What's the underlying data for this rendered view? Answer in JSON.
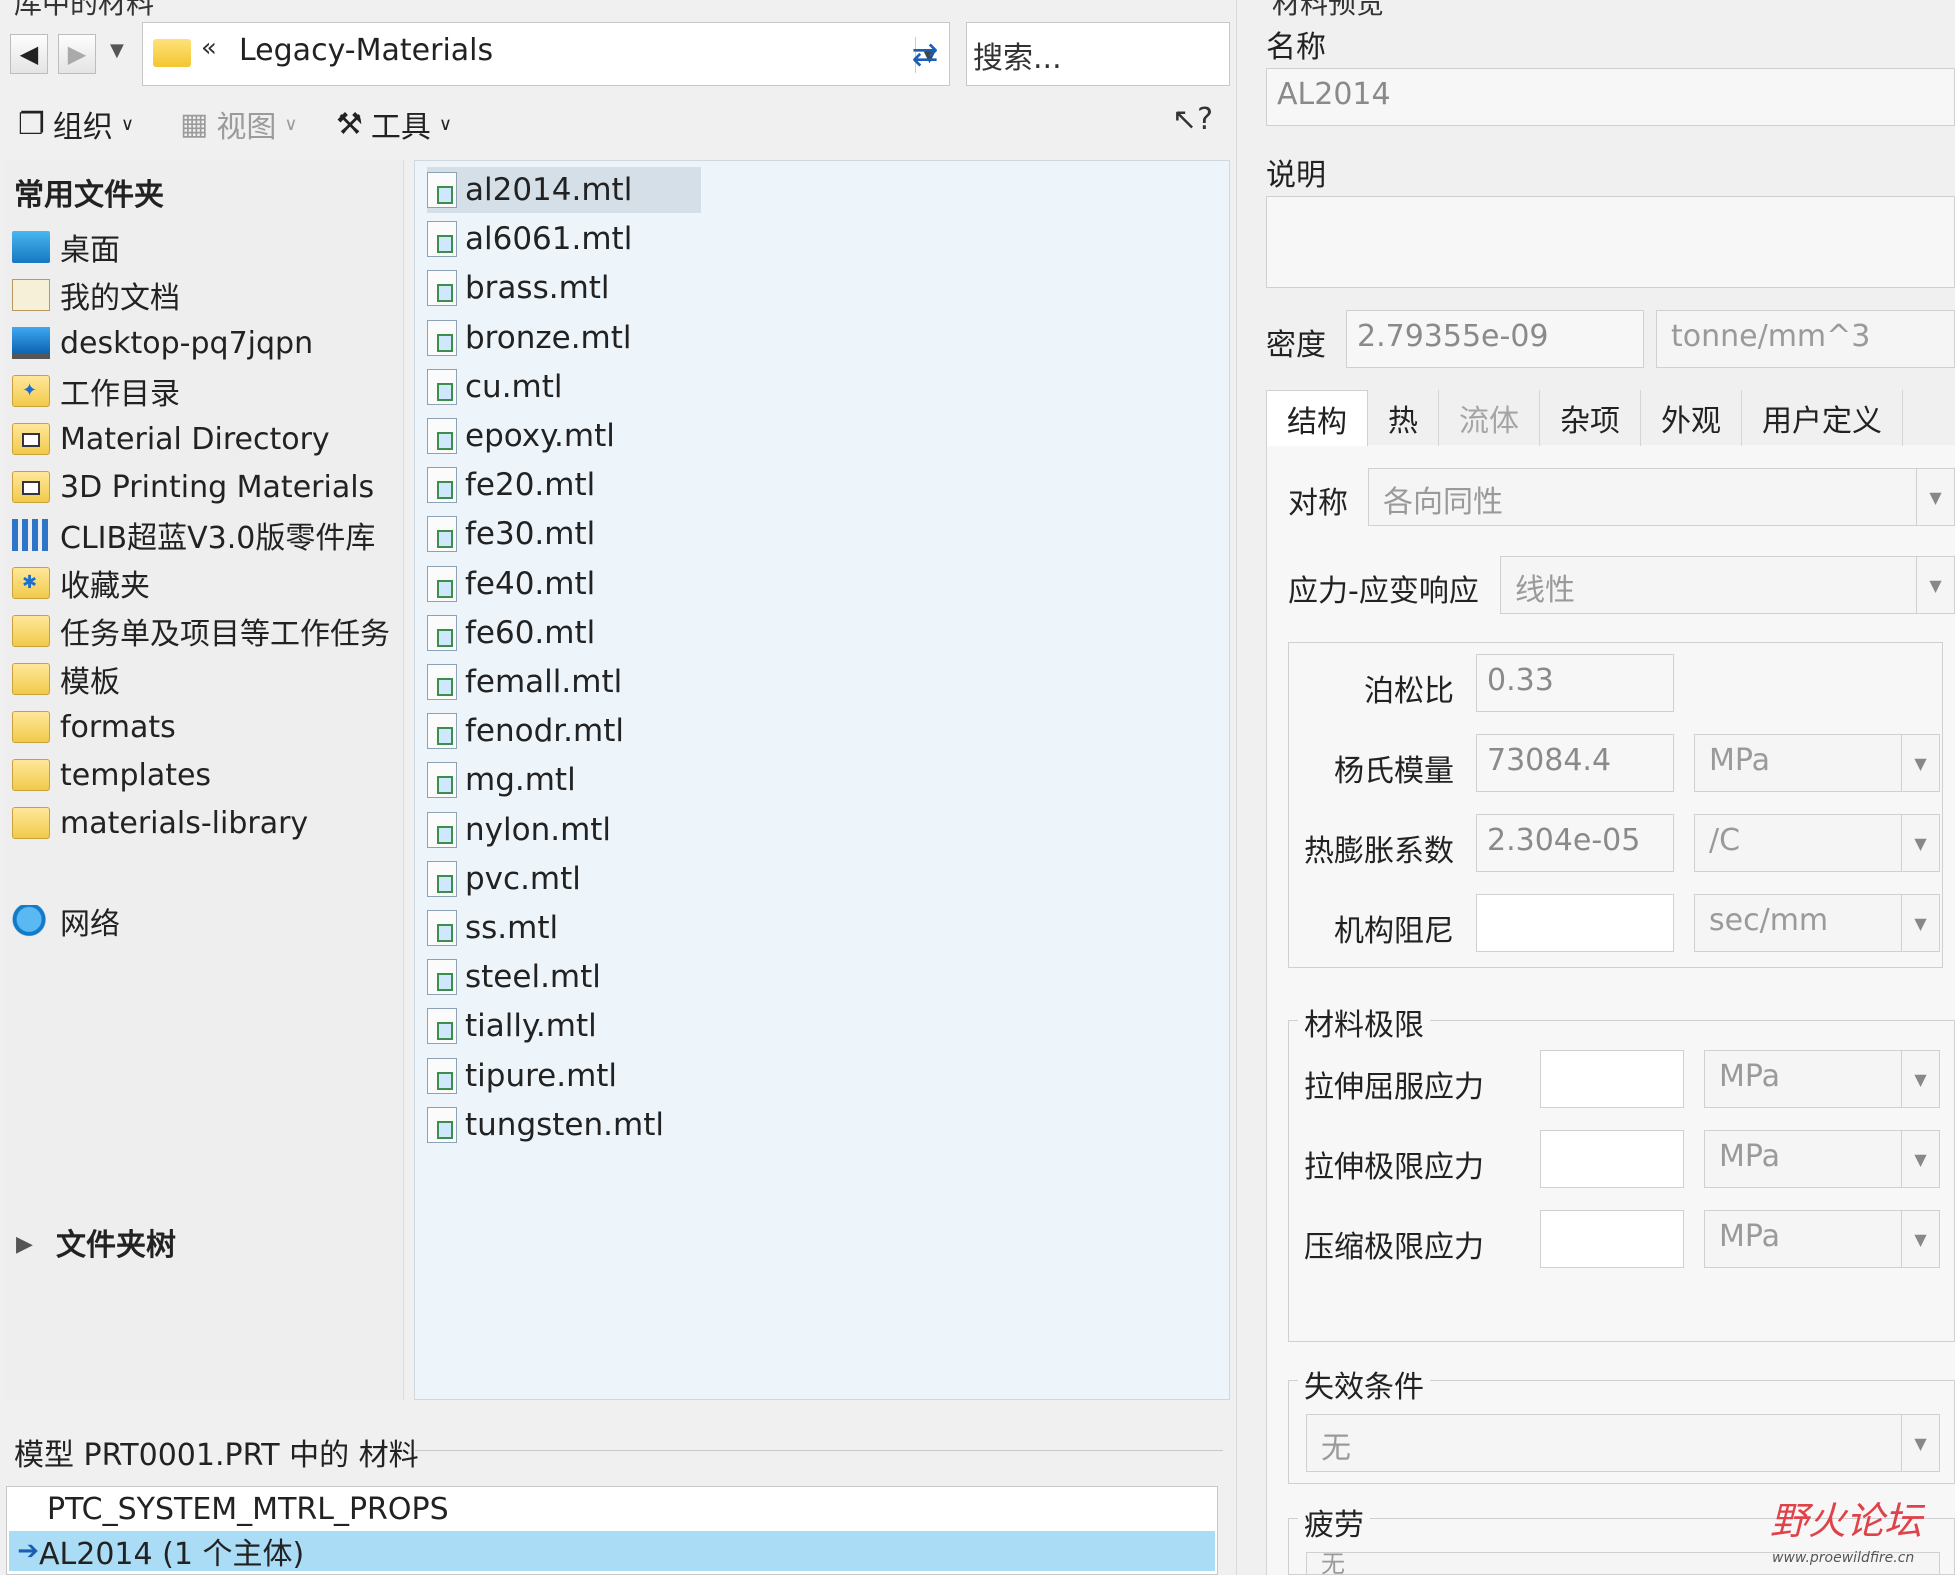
{
  "left": {
    "section_title": "库中的材料",
    "path": {
      "chevron": "«",
      "text": "Legacy-Materials"
    },
    "search_placeholder": "搜索...",
    "toolbar": {
      "organize": "组织",
      "view": "视图",
      "tools": "工具"
    },
    "folders_heading": "常用文件夹",
    "folders": [
      {
        "label": "桌面",
        "icon": "desktop-icon"
      },
      {
        "label": "我的文档",
        "icon": "documents-icon"
      },
      {
        "label": "desktop-pq7jqpn",
        "icon": "computer-icon"
      },
      {
        "label": "工作目录",
        "icon": "working-dir-icon"
      },
      {
        "label": "Material Directory",
        "icon": "material-folder-icon"
      },
      {
        "label": "3D Printing Materials",
        "icon": "material-folder-icon"
      },
      {
        "label": "CLIB超蓝V3.0版零件库",
        "icon": "library-icon"
      },
      {
        "label": "收藏夹",
        "icon": "favorites-icon"
      },
      {
        "label": "任务单及项目等工作任务",
        "icon": "folder-icon"
      },
      {
        "label": "模板",
        "icon": "folder-icon"
      },
      {
        "label": "formats",
        "icon": "folder-icon"
      },
      {
        "label": "templates",
        "icon": "folder-icon"
      },
      {
        "label": "materials-library",
        "icon": "folder-icon"
      }
    ],
    "network": "网络",
    "folder_tree": "文件夹树",
    "files": [
      "al2014.mtl",
      "al6061.mtl",
      "brass.mtl",
      "bronze.mtl",
      "cu.mtl",
      "epoxy.mtl",
      "fe20.mtl",
      "fe30.mtl",
      "fe40.mtl",
      "fe60.mtl",
      "femall.mtl",
      "fenodr.mtl",
      "mg.mtl",
      "nylon.mtl",
      "pvc.mtl",
      "ss.mtl",
      "steel.mtl",
      "tially.mtl",
      "tipure.mtl",
      "tungsten.mtl"
    ],
    "selected_file": "al2014.mtl",
    "model_title": "模型 PRT0001.PRT 中的 材料",
    "model_items": [
      "PTC_SYSTEM_MTRL_PROPS",
      "AL2014 (1 个主体)"
    ]
  },
  "right": {
    "heading": "材料预览",
    "name_label": "名称",
    "name_value": "AL2014",
    "desc_label": "说明",
    "desc_value": "",
    "density_label": "密度",
    "density_value": "2.79355e-09",
    "density_unit": "tonne/mm^3",
    "tabs": [
      "结构",
      "热",
      "流体",
      "杂项",
      "外观",
      "用户定义"
    ],
    "symmetry_label": "对称",
    "symmetry_value": "各向同性",
    "stress_strain_label": "应力-应变响应",
    "stress_strain_value": "线性",
    "poisson_label": "泊松比",
    "poisson_value": "0.33",
    "young_label": "杨氏模量",
    "young_value": "73084.4",
    "young_unit": "MPa",
    "thermal_label": "热膨胀系数",
    "thermal_value": "2.304e-05",
    "thermal_unit": "/C",
    "damping_label": "机构阻尼",
    "damping_value": "",
    "damping_unit": "sec/mm",
    "limits_title": "材料极限",
    "tensile_yield_label": "拉伸屈服应力",
    "tensile_yield_unit": "MPa",
    "tensile_ultimate_label": "拉伸极限应力",
    "tensile_ultimate_unit": "MPa",
    "compressive_label": "压缩极限应力",
    "compressive_unit": "MPa",
    "failure_title": "失效条件",
    "failure_value": "无",
    "fatigue_title": "疲劳",
    "fatigue_value": "无"
  },
  "watermark": {
    "brand": "野火论坛",
    "url": "www.proewildfire.cn"
  },
  "colors": {
    "selection_blue": "#aadcf6",
    "file_selection": "#d4dfe8",
    "files_bg": "#eef5fa"
  }
}
